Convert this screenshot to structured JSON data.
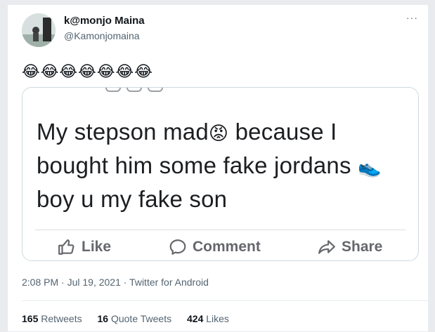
{
  "author": {
    "display_name": "k@monjo Maina",
    "handle": "@Kamonjomaina"
  },
  "tweet": {
    "text": "😂😂😂😂😂😂😂"
  },
  "embedded_post": {
    "text_part1": "My stepson mad",
    "emoji_angry": "😡",
    "text_part2": " because I bought him some fake jordans ",
    "emoji_shoe": "👟",
    "text_part3": " boy u my fake son",
    "like_label": "Like",
    "comment_label": "Comment",
    "share_label": "Share"
  },
  "meta": {
    "timestamp": "2:08 PM · Jul 19, 2021 · Twitter for Android"
  },
  "stats": {
    "retweets_count": "165",
    "retweets_label": "Retweets",
    "quotes_count": "16",
    "quotes_label": "Quote Tweets",
    "likes_count": "424",
    "likes_label": "Likes"
  },
  "colors": {
    "secondary_text": "#536471",
    "fb_action_gray": "#65676b"
  }
}
